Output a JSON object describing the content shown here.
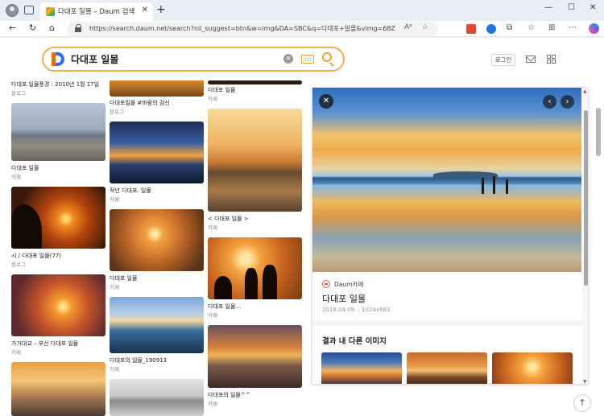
{
  "browser": {
    "tab_title": "다대포 일몰 – Daum 검색",
    "tab_close": "✕",
    "new_tab": "+",
    "url": "https://search.daum.net/search?nil_suggest=btn&w=img&DA=SBC&q=다대포+일몰&vimg=68ZxAyXyX9...",
    "read_aloud": "Aᵃ",
    "extensions": [
      {
        "label": "EX",
        "color": "#2b6cd6"
      },
      {
        "label": "",
        "color": "#e24b2b"
      },
      {
        "label": "",
        "color": "#f07a1a"
      },
      {
        "label": "",
        "color": "#1e74e8"
      }
    ],
    "win_min": "—",
    "win_max": "☐",
    "win_close": "✕"
  },
  "search": {
    "query": "다대포 일몰",
    "clear": "✕",
    "login": "로그인"
  },
  "results": {
    "col1": [
      {
        "caption": "다대포 일몰풍경 : 2010년 1월 17일",
        "source": "블로그"
      },
      {
        "caption": "다대포 일몰",
        "source": "카페"
      },
      {
        "caption": "시 / 다대포 일몰(77)",
        "source": "블로그"
      },
      {
        "caption": "가거대교 – 부산 다대포 일몰",
        "source": "카페"
      }
    ],
    "col2": [
      {
        "caption": "다대포일몰 #바람의 검신",
        "source": "블로그"
      },
      {
        "caption": "작년 다대포. 일몰",
        "source": "카페"
      },
      {
        "caption": "다대포 일몰",
        "source": "카페"
      },
      {
        "caption": "다대포의 일몰_190913",
        "source": "카페"
      }
    ],
    "col3": [
      {
        "caption": "다대포 일몰",
        "source": "카페"
      },
      {
        "caption": "< 다대포 일몰 >",
        "source": "카페"
      },
      {
        "caption": "다대포 일몰...",
        "source": "카페"
      },
      {
        "caption": "다대포의 일몰^^",
        "source": "카페"
      }
    ]
  },
  "preview": {
    "close": "✕",
    "prev": "‹",
    "next": "›",
    "source": "Daum카페",
    "title": "다대포 일몰",
    "date": "2018.04.09.",
    "size": "1024x683",
    "related_heading": "결과 내 다른 이미지"
  },
  "to_top": "↑",
  "colors": {
    "accent": "#f2b24e",
    "daum_blue": "#2f6bff",
    "daum_orange": "#ff6a00"
  }
}
